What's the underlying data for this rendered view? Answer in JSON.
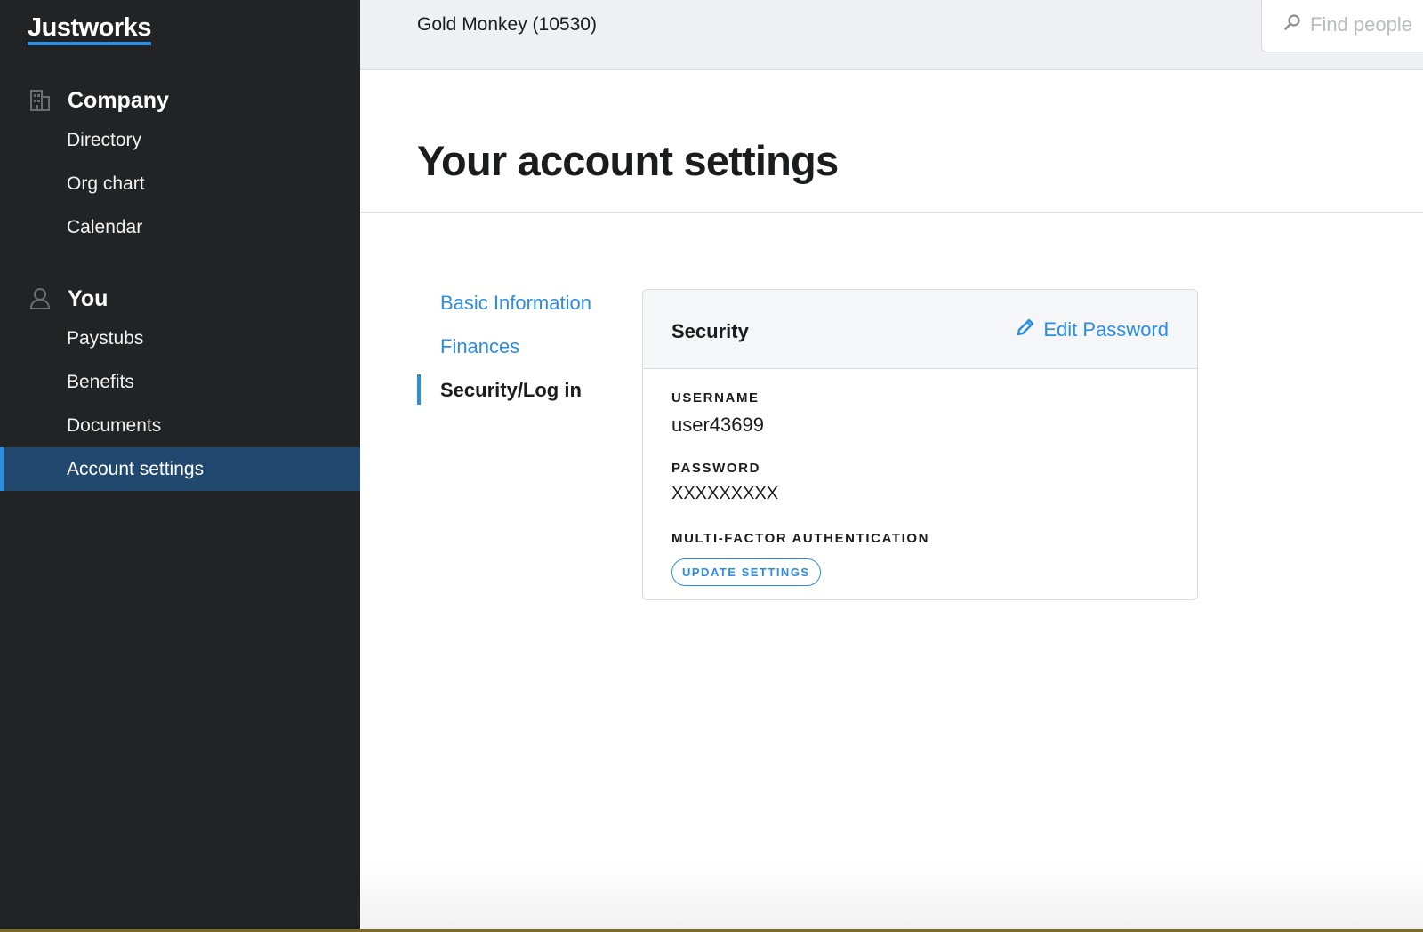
{
  "sidebar": {
    "logo": "Justworks",
    "sections": [
      {
        "heading": "Company",
        "icon": "building-icon",
        "items": [
          "Directory",
          "Org chart",
          "Calendar"
        ]
      },
      {
        "heading": "You",
        "icon": "person-icon",
        "items": [
          "Paystubs",
          "Benefits",
          "Documents",
          "Account settings"
        ]
      }
    ],
    "active_item": "Account settings"
  },
  "header": {
    "company": "Gold Monkey (10530)",
    "search_placeholder": "Find people"
  },
  "main": {
    "title": "Your account settings",
    "subnav": [
      "Basic Information",
      "Finances",
      "Security/Log in"
    ],
    "active_subnav": "Security/Log in",
    "card": {
      "title": "Security",
      "edit_label": "Edit Password",
      "username_label": "USERNAME",
      "username_value": "user43699",
      "password_label": "PASSWORD",
      "password_value": "XXXXXXXXX",
      "mfa_label": "MULTI-FACTOR AUTHENTICATION",
      "mfa_button": "UPDATE SETTINGS"
    }
  },
  "colors": {
    "sidebar_bg": "#222324",
    "active_bg": "#21496f",
    "accent": "#2b8de4"
  }
}
